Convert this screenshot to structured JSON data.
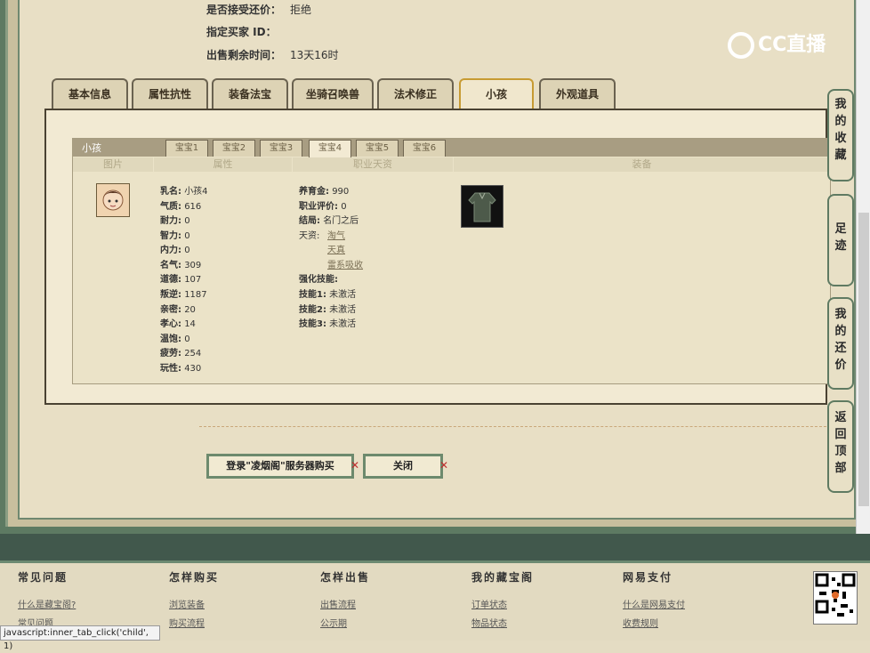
{
  "header": {
    "rows": [
      {
        "label": "是否接受还价：",
        "value": "拒绝"
      },
      {
        "label": "指定买家 ID：",
        "value": ""
      },
      {
        "label": "出售剩余时间：",
        "value": "13天16时"
      }
    ],
    "logo_text": "CC直播"
  },
  "tabs": [
    "基本信息",
    "属性抗性",
    "装备法宝",
    "坐骑召唤兽",
    "法术修正",
    "小孩",
    "外观道具"
  ],
  "active_tab": "小孩",
  "child_panel": {
    "title": "小孩",
    "subtabs": [
      "宝宝1",
      "宝宝2",
      "宝宝3",
      "宝宝4",
      "宝宝5",
      "宝宝6"
    ],
    "active_subtab": "宝宝4",
    "columns": [
      "图片",
      "属性",
      "职业天资",
      "装备"
    ],
    "attributes": [
      {
        "k": "乳名:",
        "v": "小孩4"
      },
      {
        "k": "气质:",
        "v": "616"
      },
      {
        "k": "耐力:",
        "v": "0"
      },
      {
        "k": "智力:",
        "v": "0"
      },
      {
        "k": "内力:",
        "v": "0"
      },
      {
        "k": "名气:",
        "v": "309"
      },
      {
        "k": "道德:",
        "v": "107"
      },
      {
        "k": "叛逆:",
        "v": "1187"
      },
      {
        "k": "亲密:",
        "v": "20"
      },
      {
        "k": "孝心:",
        "v": "14"
      },
      {
        "k": "温饱:",
        "v": "0"
      },
      {
        "k": "疲劳:",
        "v": "254"
      },
      {
        "k": "玩性:",
        "v": "430"
      }
    ],
    "career": {
      "yangyujin": {
        "k": "养育金:",
        "v": "990"
      },
      "pingjia": {
        "k": "职业评价:",
        "v": "0"
      },
      "jieju": {
        "k": "结局:",
        "v": "名门之后"
      },
      "tianzi_label": "天资:",
      "tianzi": [
        "淘气",
        "天真",
        "雷系吸收"
      ],
      "skills_label": "强化技能:",
      "skills": [
        {
          "k": "技能1:",
          "v": "未激活"
        },
        {
          "k": "技能2:",
          "v": "未激活"
        },
        {
          "k": "技能3:",
          "v": "未激活"
        }
      ]
    }
  },
  "buttons": {
    "buy": "登录\"凌烟阁\"服务器购买",
    "close": "关闭"
  },
  "side_buttons": [
    "我的收藏",
    "足迹",
    "我的还价",
    "返回顶部"
  ],
  "footer": {
    "columns": [
      {
        "title": "常见问题",
        "links": [
          "什么是藏宝阁?",
          "常见问题"
        ]
      },
      {
        "title": "怎样购买",
        "links": [
          "浏览装备",
          "购买流程"
        ]
      },
      {
        "title": "怎样出售",
        "links": [
          "出售流程",
          "公示期"
        ]
      },
      {
        "title": "我的藏宝阁",
        "links": [
          "订单状态",
          "物品状态"
        ]
      },
      {
        "title": "网易支付",
        "links": [
          "什么是网易支付",
          "收费规则"
        ]
      }
    ]
  },
  "status_bar": "javascript:inner_tab_click('child', 1)",
  "colors": {
    "accent_green": "#5d7a62",
    "active_tab_border": "#c79b33",
    "close_x": "#c03030"
  }
}
